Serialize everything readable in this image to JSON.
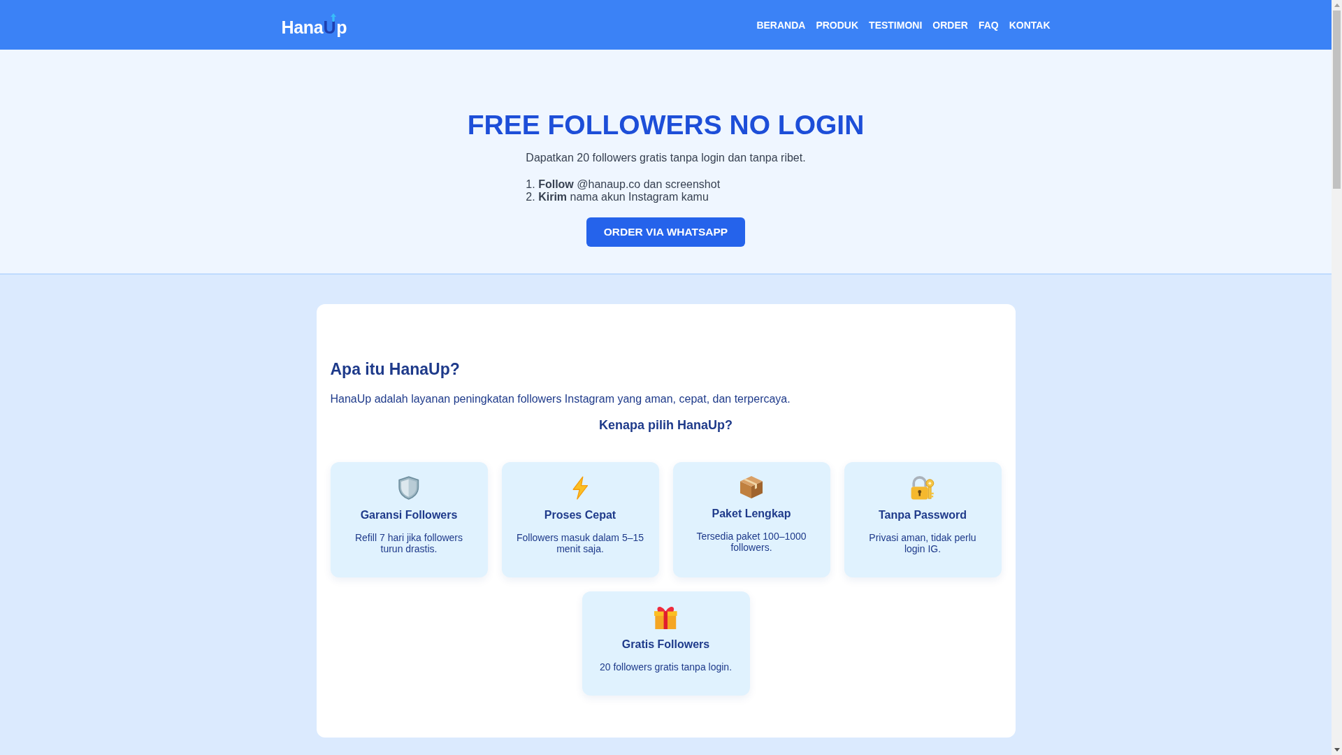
{
  "header": {
    "logo": {
      "lead": "Hana",
      "accent": "U",
      "tail": "p"
    },
    "nav": [
      "BERANDA",
      "PRODUK",
      "TESTIMONI",
      "ORDER",
      "FAQ",
      "KONTAK"
    ]
  },
  "hero": {
    "title": "FREE FOLLOWERS NO LOGIN",
    "subtitle": "Dapatkan 20 followers gratis tanpa login dan tanpa ribet.",
    "steps": [
      {
        "number": "1.",
        "text": "**Follow** @hanaup.co dan screenshot"
      },
      {
        "number": "2.",
        "text": "**Kirim** nama akun Instagram kamu"
      }
    ],
    "button": "ORDER VIA WHATSAPP"
  },
  "about": {
    "heading": "Apa itu HanaUp?",
    "description": "HanaUp adalah layanan peningkatan followers Instagram yang aman, cepat, dan terpercaya.",
    "features_heading": "Kenapa pilih HanaUp?",
    "features": [
      {
        "title": "Garansi Followers",
        "text": "Refill 7 hari jika followers turun drastis."
      },
      {
        "title": "Proses Cepat",
        "text": "Followers masuk dalam 5–15 menit saja."
      },
      {
        "title": "Paket Lengkap",
        "text": "Tersedia paket 100–1000 followers."
      },
      {
        "title": "Tanpa Password",
        "text": "Privasi aman, tidak perlu login IG."
      },
      {
        "title": "Gratis Followers",
        "text": "20 followers gratis tanpa login."
      }
    ]
  }
}
